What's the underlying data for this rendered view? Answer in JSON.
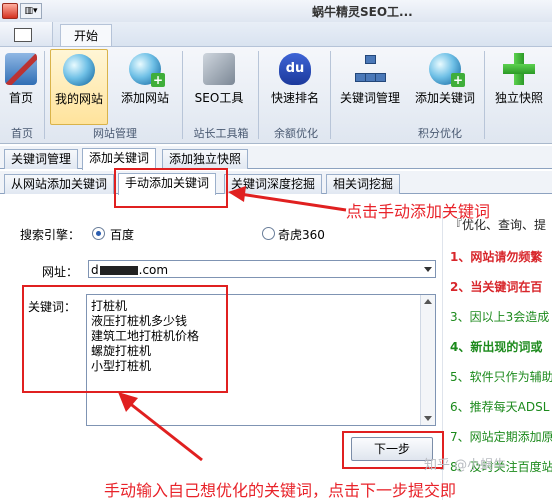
{
  "window": {
    "title": "蜗牛精灵SEO工..."
  },
  "ribbon_tab": "开始",
  "ribbon": {
    "buttons": [
      {
        "label": "首页",
        "icon": "home-icon"
      },
      {
        "label": "我的网站",
        "icon": "globe-icon"
      },
      {
        "label": "添加网站",
        "icon": "globe-add-icon"
      },
      {
        "label": "SEO工具",
        "icon": "tools-icon"
      },
      {
        "label": "快速排名",
        "icon": "baidu-icon"
      },
      {
        "label": "关键词管理",
        "icon": "network-icon"
      },
      {
        "label": "添加关键词",
        "icon": "globe-add-icon"
      },
      {
        "label": "独立快照",
        "icon": "green-plus-icon"
      }
    ],
    "groups": [
      "首页",
      "网站管理",
      "站长工具箱",
      "余额优化",
      "积分优化"
    ],
    "du_text": "du"
  },
  "tabs_level1": [
    "关键词管理",
    "添加关键词",
    "添加独立快照"
  ],
  "tabs_level2": [
    "从网站添加关键词",
    "手动添加关键词",
    "关键词深度挖掘",
    "相关词挖掘"
  ],
  "form": {
    "engine_label": "搜索引擎：",
    "engine_options": [
      "百度",
      "奇虎360"
    ],
    "engine_selected": "百度",
    "url_label": "网址：",
    "url_prefix": "d",
    "url_suffix": ".com",
    "keywords_label": "关键词：",
    "keywords": [
      "打桩机",
      "液压打桩机多少钱",
      "建筑工地打桩机价格",
      "螺旋打桩机",
      "小型打桩机"
    ],
    "next_button": "下一步"
  },
  "notes": {
    "header": "『优化、查询、提",
    "items": [
      {
        "text": "1、网站请勿频繁",
        "color": "#d8262b"
      },
      {
        "text": "2、当关键词在百",
        "color": "#d8262b"
      },
      {
        "text": "3、因以上3会造成",
        "color": "#1c8a1c"
      },
      {
        "text": "4、新出现的词或",
        "color": "#1c8a1c"
      },
      {
        "text": "5、软件只作为辅助",
        "color": "#1c8a1c"
      },
      {
        "text": "6、推荐每天ADSL",
        "color": "#1c8a1c"
      },
      {
        "text": "7、网站定期添加原",
        "color": "#1c8a1c"
      },
      {
        "text": "8、及时关注百度站",
        "color": "#1c8a1c"
      }
    ]
  },
  "annotations": {
    "top": "点击手动添加关键词",
    "bottom": "手动输入自己想优化的关键词，点击下一步提交即"
  },
  "watermark": "知乎 @小蜗牛"
}
